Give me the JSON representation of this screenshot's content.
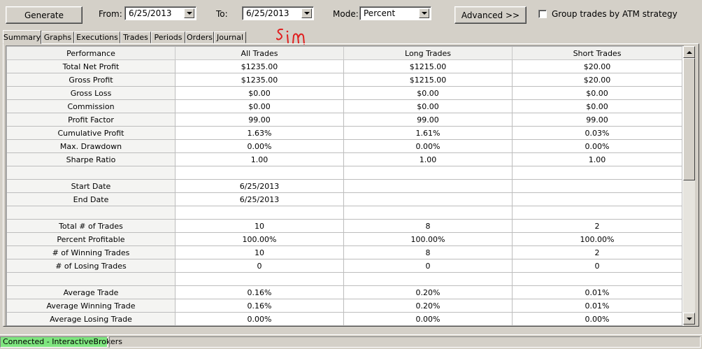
{
  "toolbar": {
    "generate_label": "Generate",
    "from_label": "From:",
    "from_value": "6/25/2013",
    "to_label": "To:",
    "to_value": "6/25/2013",
    "mode_label": "Mode:",
    "mode_value": "Percent",
    "advanced_label": "Advanced >>",
    "group_trades_label": "Group trades by ATM strategy",
    "group_trades_checked": false
  },
  "annotation": "sim",
  "tabs": [
    "Summary",
    "Graphs",
    "Executions",
    "Trades",
    "Periods",
    "Orders",
    "Journal"
  ],
  "active_tab": "Summary",
  "table": {
    "columns": [
      "Performance",
      "All Trades",
      "Long Trades",
      "Short Trades"
    ],
    "rows": [
      [
        "Total Net Profit",
        "$1235.00",
        "$1215.00",
        "$20.00"
      ],
      [
        "Gross Profit",
        "$1235.00",
        "$1215.00",
        "$20.00"
      ],
      [
        "Gross Loss",
        "$0.00",
        "$0.00",
        "$0.00"
      ],
      [
        "Commission",
        "$0.00",
        "$0.00",
        "$0.00"
      ],
      [
        "Profit Factor",
        "99.00",
        "99.00",
        "99.00"
      ],
      [
        "Cumulative Profit",
        "1.63%",
        "1.61%",
        "0.03%"
      ],
      [
        "Max. Drawdown",
        "0.00%",
        "0.00%",
        "0.00%"
      ],
      [
        "Sharpe Ratio",
        "1.00",
        "1.00",
        "1.00"
      ],
      [
        "",
        "",
        "",
        ""
      ],
      [
        "Start Date",
        "6/25/2013",
        "",
        ""
      ],
      [
        "End Date",
        "6/25/2013",
        "",
        ""
      ],
      [
        "",
        "",
        "",
        ""
      ],
      [
        "Total # of Trades",
        "10",
        "8",
        "2"
      ],
      [
        "Percent Profitable",
        "100.00%",
        "100.00%",
        "100.00%"
      ],
      [
        "# of Winning Trades",
        "10",
        "8",
        "2"
      ],
      [
        "# of Losing Trades",
        "0",
        "0",
        "0"
      ],
      [
        "",
        "",
        "",
        ""
      ],
      [
        "Average Trade",
        "0.16%",
        "0.20%",
        "0.01%"
      ],
      [
        "Average Winning Trade",
        "0.16%",
        "0.20%",
        "0.01%"
      ],
      [
        "Average Losing Trade",
        "0.00%",
        "0.00%",
        "0.00%"
      ]
    ]
  },
  "status": {
    "connection": "Connected - InteractiveBrokers"
  },
  "colors": {
    "connected_bg": "#7fe57f",
    "annotation": "#e02020",
    "window_bg": "#d4d0c8"
  }
}
